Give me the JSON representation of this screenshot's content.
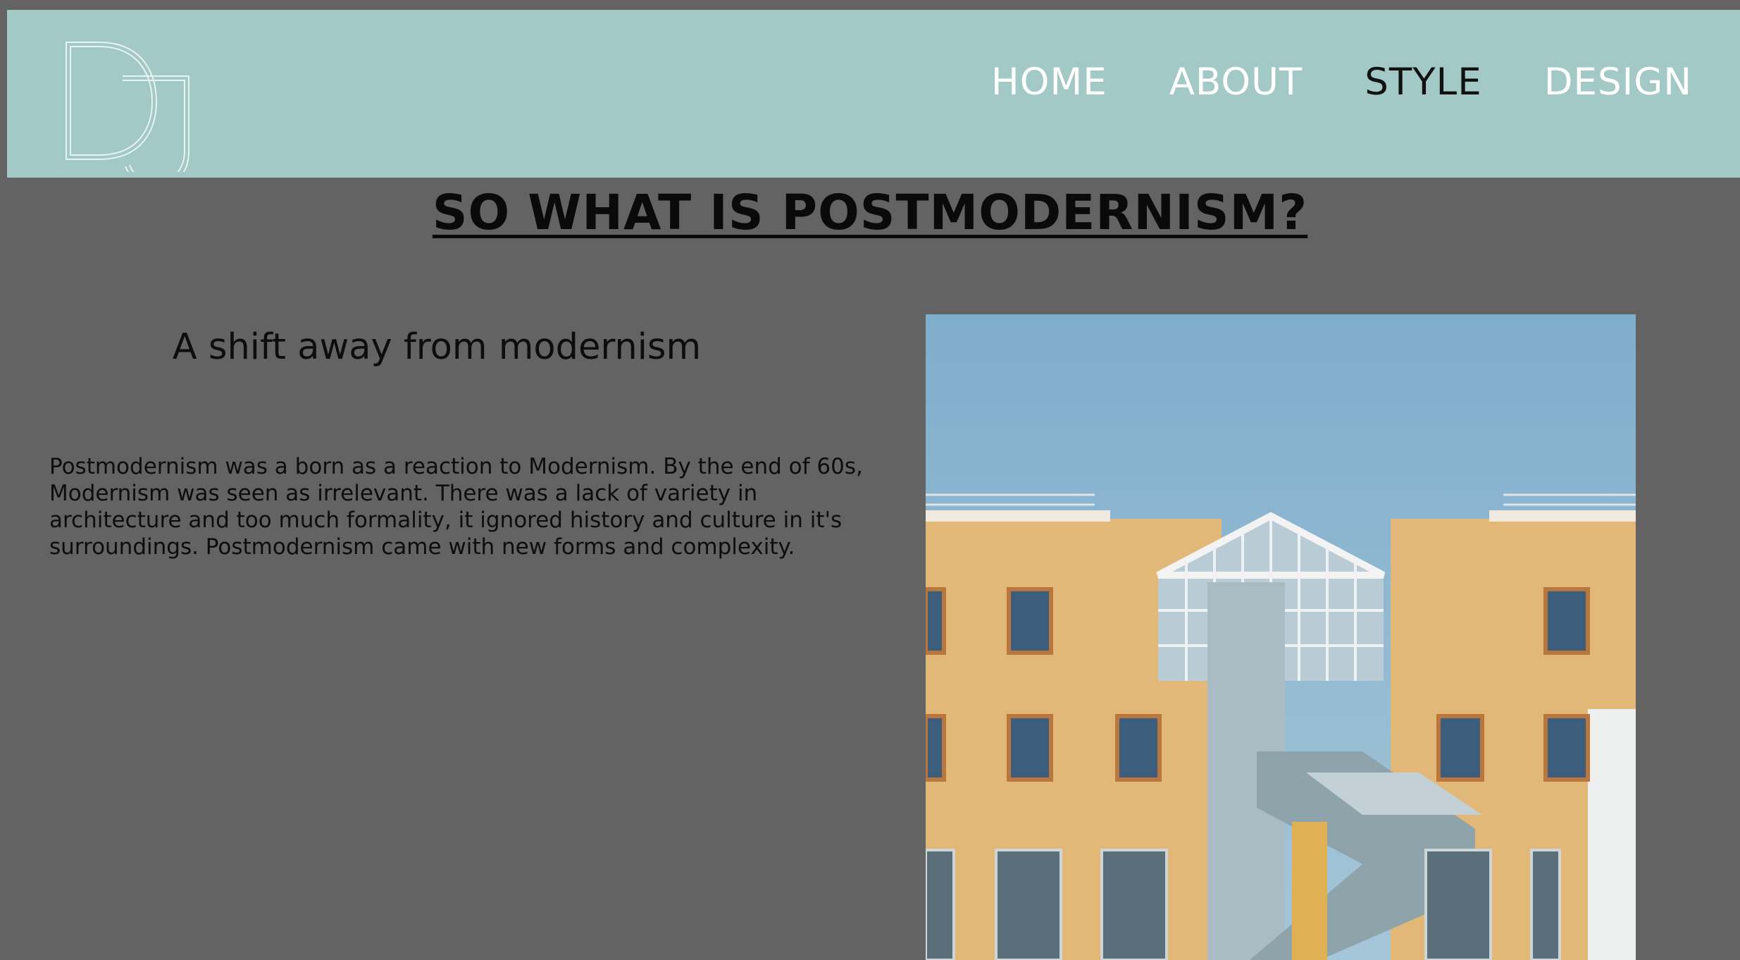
{
  "header": {
    "background_color": "#a3c9c6",
    "logo": {
      "icon": "dj-monogram-logo",
      "text": "DJ"
    },
    "nav": [
      {
        "label": "HOME",
        "active": false
      },
      {
        "label": "ABOUT",
        "active": false
      },
      {
        "label": "STYLE",
        "active": true
      },
      {
        "label": "DESIGN",
        "active": false
      }
    ]
  },
  "main": {
    "title": "SO WHAT IS POSTMODERNISM?",
    "subtitle": "A shift away from modernism",
    "paragraph": "Postmodernism was a born as a reaction to Modernism. By the end of 60s, Modernism was seen as irrelevant. There was a lack of variety in architecture and too much formality, it ignored history and culture in it's surroundings. Postmodernism came with new forms and complexity.",
    "image": {
      "icon": "postmodern-building-photo"
    }
  },
  "colors": {
    "page_background": "#636363",
    "nav_text": "#ffffff",
    "nav_active_text": "#111111",
    "heading_text": "#0a0a0a"
  }
}
